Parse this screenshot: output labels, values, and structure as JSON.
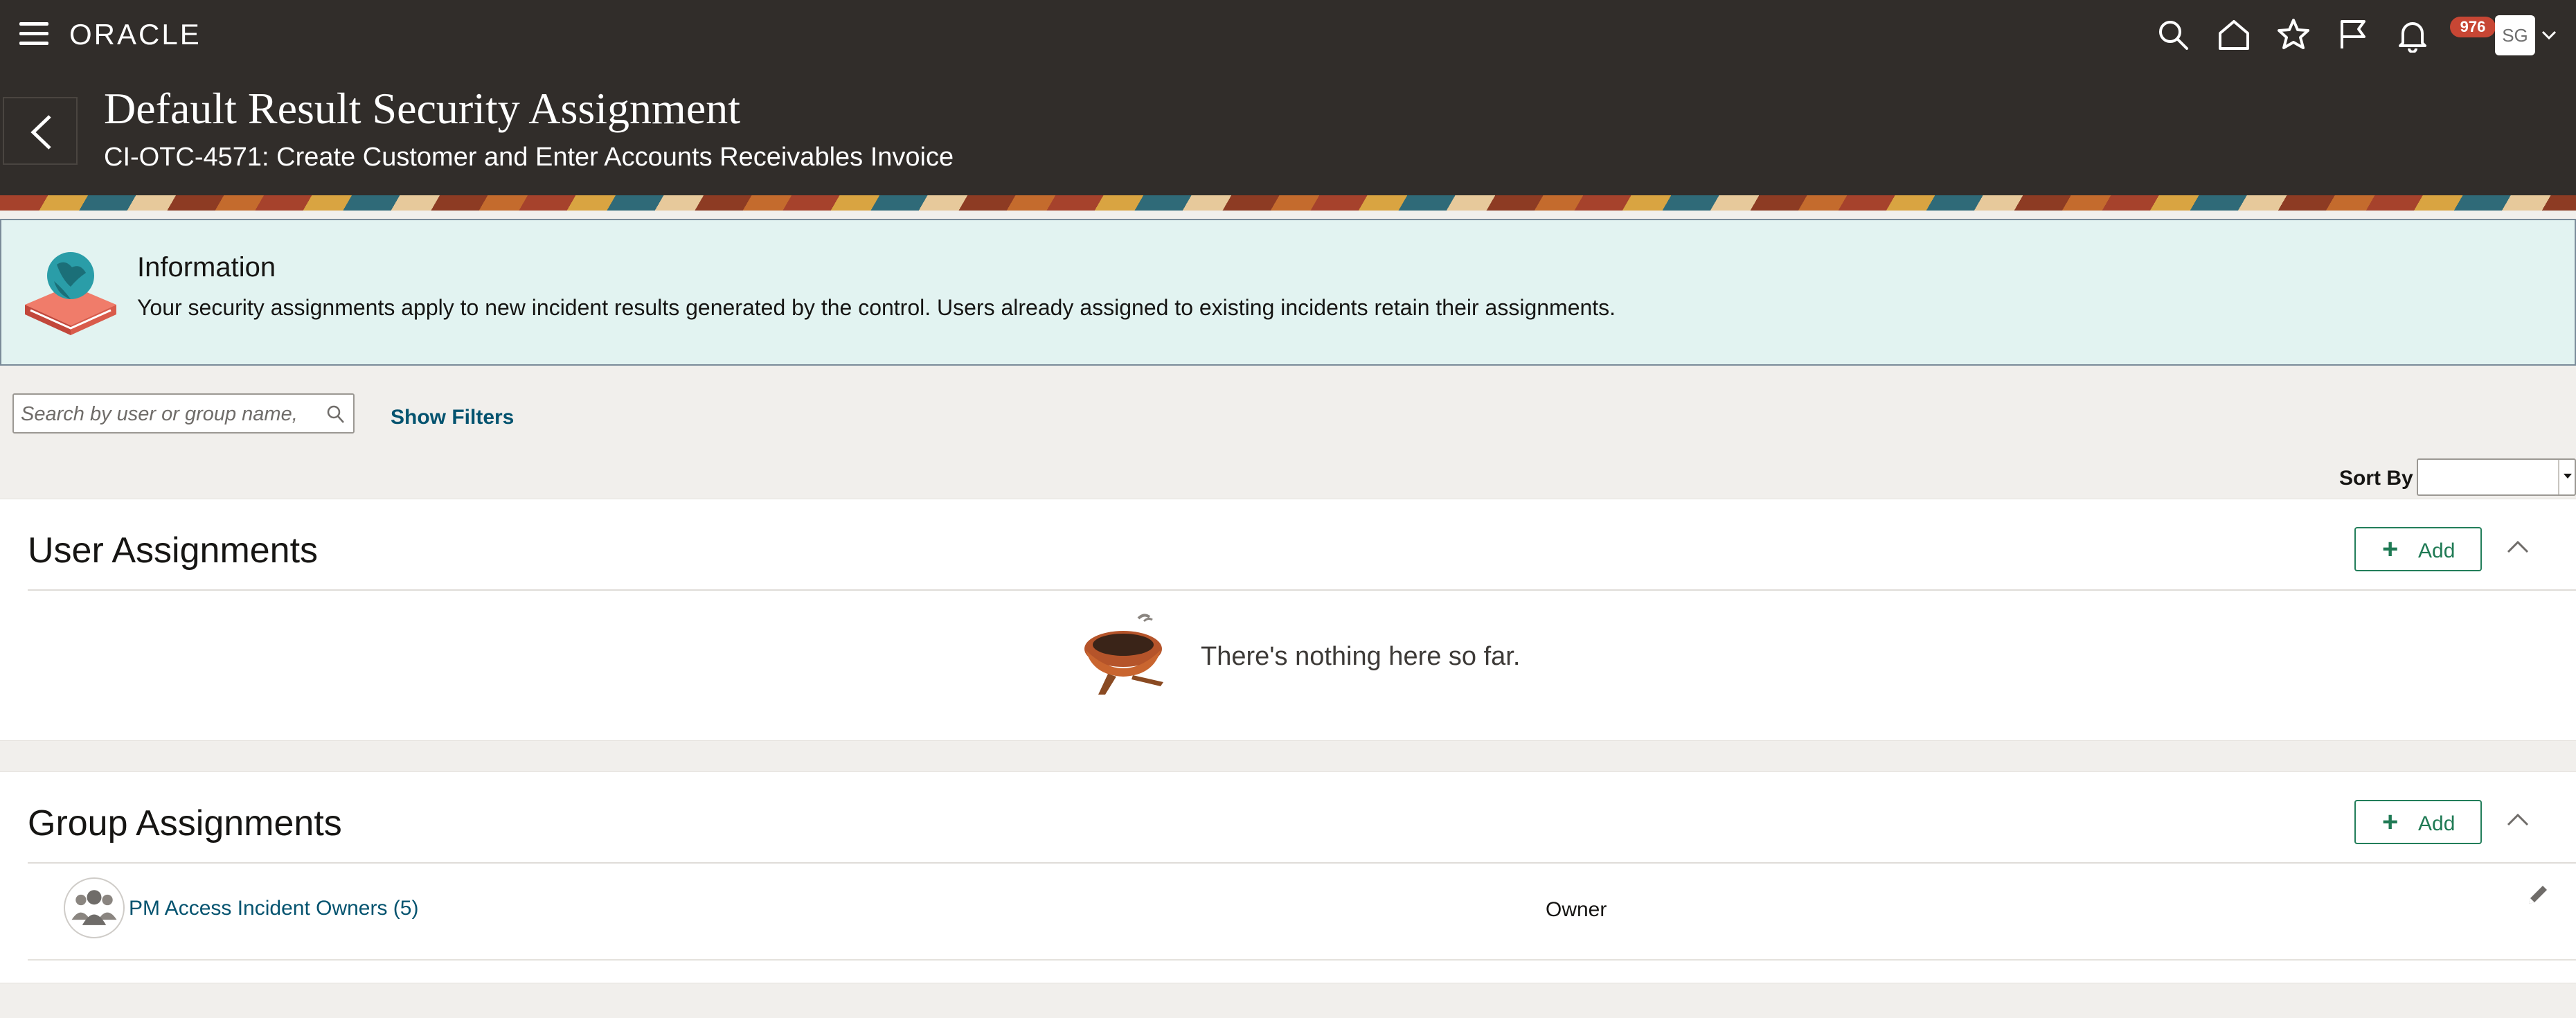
{
  "topbar": {
    "brand": "ORACLE",
    "notifications_count": "976",
    "user_initials": "SG",
    "icons": [
      "menu-icon",
      "search-icon",
      "home-icon",
      "star-icon",
      "flag-icon",
      "bell-icon",
      "chevron-down-icon"
    ]
  },
  "header": {
    "title": "Default Result Security Assignment",
    "subtitle": "CI-OTC-4571: Create Customer and Enter Accounts Receivables Invoice"
  },
  "info": {
    "title": "Information",
    "message": "Your security assignments apply to new incident results generated by the control. Users already assigned to existing incidents retain their assignments."
  },
  "search": {
    "placeholder": "Search by user or group name,",
    "value": ""
  },
  "filters": {
    "show_filters_label": "Show Filters"
  },
  "sort": {
    "label": "Sort By",
    "selected": ""
  },
  "user_assignments": {
    "title": "User Assignments",
    "add_label": "Add",
    "empty_message": "There's nothing here so far."
  },
  "group_assignments": {
    "title": "Group Assignments",
    "add_label": "Add",
    "rows": [
      {
        "name": "PM Access Incident Owners (5)",
        "role": "Owner"
      }
    ]
  },
  "colors": {
    "topbar_bg": "#312d2a",
    "accent_green": "#227e5a",
    "link_blue": "#04536f",
    "badge_red": "#c74634",
    "info_bg": "#e2f3f1"
  }
}
